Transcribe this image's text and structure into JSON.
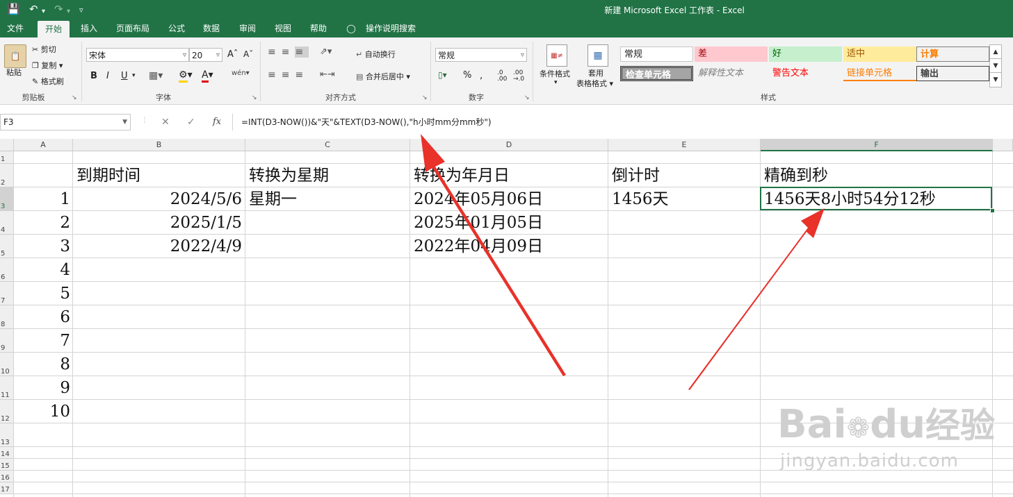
{
  "app": {
    "title": "新建 Microsoft Excel 工作表  -  Excel"
  },
  "tabs": [
    "文件",
    "开始",
    "插入",
    "页面布局",
    "公式",
    "数据",
    "审阅",
    "视图",
    "帮助",
    "操作说明搜索"
  ],
  "clipboard": {
    "paste": "粘贴",
    "cut": "剪切",
    "copy": "复制",
    "format_painter": "格式刷",
    "label": "剪贴板"
  },
  "font": {
    "name": "宋体",
    "size": "20",
    "label": "字体",
    "bold": "B",
    "italic": "I",
    "underline": "U"
  },
  "alignment": {
    "wrap": "自动换行",
    "merge": "合并后居中",
    "label": "对齐方式"
  },
  "number": {
    "format": "常规",
    "label": "数字",
    "percent": "%"
  },
  "styles": {
    "conditional": "条件格式",
    "table_format_1": "套用",
    "table_format_2": "表格格式",
    "label": "样式",
    "cells": [
      {
        "label": "常规"
      },
      {
        "label": "差"
      },
      {
        "label": "好"
      },
      {
        "label": "适中"
      },
      {
        "label": "计算"
      },
      {
        "label": "检查单元格"
      },
      {
        "label": "解释性文本"
      },
      {
        "label": "警告文本"
      },
      {
        "label": "链接单元格"
      },
      {
        "label": "输出"
      }
    ]
  },
  "formula_bar": {
    "name_box": "F3",
    "formula": "=INT(D3-NOW())&\"天\"&TEXT(D3-NOW(),\"h小时mm分mm秒\")"
  },
  "sheet": {
    "columns": [
      "A",
      "B",
      "C",
      "D",
      "E",
      "F"
    ],
    "rows": [
      "1",
      "2",
      "3",
      "4",
      "5",
      "6",
      "7",
      "8",
      "9",
      "10",
      "11",
      "12",
      "13",
      "14",
      "15",
      "16",
      "17"
    ],
    "headers": {
      "b": "到期时间",
      "c": "转换为星期",
      "d": "转换为年月日",
      "e": "倒计时",
      "f": "精确到秒"
    },
    "a_values": [
      "1",
      "2",
      "3",
      "4",
      "5",
      "6",
      "7",
      "8",
      "9",
      "10"
    ],
    "b_values": [
      "2024/5/6",
      "2025/1/5",
      "2022/4/9"
    ],
    "c3": "星期一",
    "d_values": [
      "2024年05月06日",
      "2025年01月05日",
      "2022年04月09日"
    ],
    "e3": "1456天",
    "f3": "1456天8小时54分12秒"
  },
  "watermark": {
    "brand": "Bai",
    "brand2": "du",
    "cn": "经验",
    "url": "jingyan.baidu.com"
  },
  "colors": {
    "excel_green": "#217346",
    "arrow_red": "#e8322a"
  }
}
